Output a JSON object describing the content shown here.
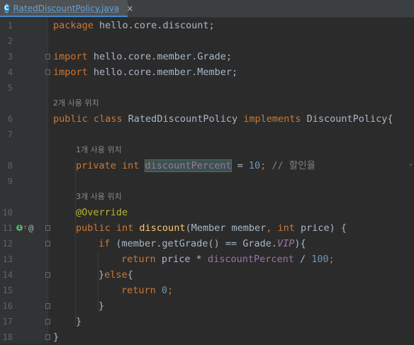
{
  "tab": {
    "file_icon_letter": "C",
    "filename": "RatedDiscountPolicy.java",
    "close_glyph": "×"
  },
  "gutter": {
    "line_numbers": [
      "1",
      "2",
      "3",
      "4",
      "5",
      "6",
      "7",
      "8",
      "9",
      "10",
      "11",
      "12",
      "13",
      "14",
      "15",
      "16",
      "17",
      "18"
    ],
    "impl_icon": "implementation-icon",
    "override_arrow": "↑",
    "override_at": "@"
  },
  "hints": {
    "usages_class": "2개 사용 위치",
    "usages_field": "1개 사용 위치",
    "usages_method": "3개 사용 위치"
  },
  "code": {
    "l1_kw": "package",
    "l1_rest": " hello.core.discount;",
    "l3_kw": "import",
    "l3_rest": " hello.core.member.Grade;",
    "l4_kw": "import",
    "l4_rest": " hello.core.member.Member;",
    "l6_kw1": "public class",
    "l6_name": " RatedDiscountPolicy ",
    "l6_kw2": "implements",
    "l6_rest": " DiscountPolicy{",
    "l8_kw": "private int",
    "l8_sp": " ",
    "l8_field": "discountPercent",
    "l8_eq": " = ",
    "l8_num": "10",
    "l8_semi": ";",
    "l8_comment": " // 할인율",
    "l10_ann": "@Override",
    "l11_kw": "public int",
    "l11_sp": " ",
    "l11_fn": "discount",
    "l11_p1": "(Member member",
    "l11_comma": ", ",
    "l11_kw2": "int",
    "l11_p2": " price) {",
    "l12_kw": "if",
    "l12_p1": " (member.getGrade() == Grade.",
    "l12_vip": "VIP",
    "l12_p2": "){",
    "l13_kw": "return",
    "l13_p1": " price * ",
    "l13_field": "discountPercent",
    "l13_p2": " / ",
    "l13_num": "100",
    "l13_semi": ";",
    "l14_p1": "}",
    "l14_kw": "else",
    "l14_p2": "{",
    "l15_kw": "return",
    "l15_sp": " ",
    "l15_num": "0",
    "l15_semi": ";",
    "l16": "}",
    "l17": "}",
    "l18": "}"
  },
  "colors": {
    "background": "#2b2b2b",
    "keyword": "#cc7832",
    "number": "#6897bb",
    "field": "#9876aa",
    "method": "#ffc66d",
    "annotation": "#bbb529",
    "comment": "#808080",
    "text": "#a9b7c6"
  }
}
